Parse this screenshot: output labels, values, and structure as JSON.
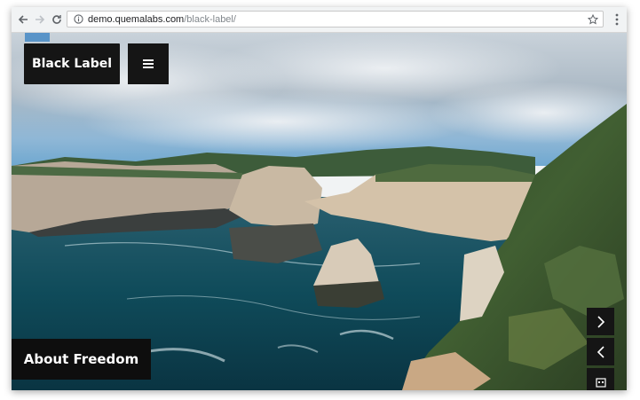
{
  "browser": {
    "url_domain": "demo.quemalabs.com",
    "url_path": "/black-label/",
    "back_icon": "arrow-left-icon",
    "forward_icon": "arrow-right-icon",
    "reload_icon": "reload-icon",
    "info_icon": "info-icon",
    "bookmark_icon": "star-icon",
    "menu_icon": "vertical-dots-icon"
  },
  "site": {
    "logo_text": "Black Label",
    "menu_icon": "hamburger-icon",
    "slide_caption": "About Freedom",
    "next_icon": "chevron-right-icon",
    "prev_icon": "chevron-left-icon",
    "gallery_icon": "gallery-icon"
  },
  "colors": {
    "button_bg": "#151515",
    "button_text": "#ffffff",
    "toolbar_bg": "#f1f3f4"
  }
}
